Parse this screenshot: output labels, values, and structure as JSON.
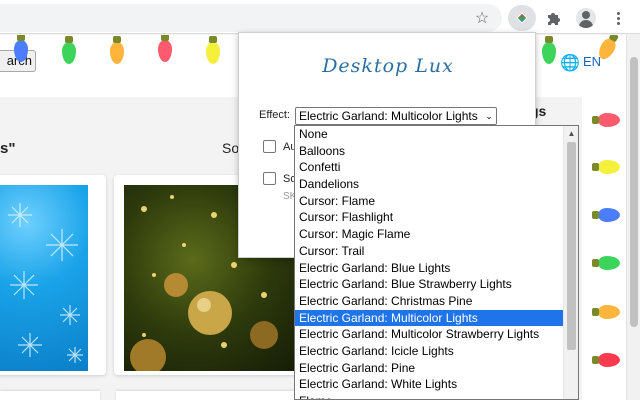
{
  "page": {
    "search_button": "arch",
    "language": "EN",
    "left_heading": "s\"",
    "center_heading": "So",
    "right_heading": "gs"
  },
  "popup": {
    "title": "Desktop Lux",
    "effect_label": "Effect:",
    "selected_effect": "Electric Garland: Multicolor Lights",
    "checkbox1_label": "Au",
    "checkbox2_label": "So",
    "checkbox2_sub": "SK"
  },
  "dropdown": {
    "options": [
      "None",
      "Balloons",
      "Confetti",
      "Dandelions",
      "Cursor: Flame",
      "Cursor: Flashlight",
      "Cursor: Magic Flame",
      "Cursor: Trail",
      "Electric Garland: Blue Lights",
      "Electric Garland: Blue Strawberry Lights",
      "Electric Garland: Christmas Pine",
      "Electric Garland: Multicolor Lights",
      "Electric Garland: Multicolor Strawberry Lights",
      "Electric Garland: Icicle Lights",
      "Electric Garland: Pine",
      "Electric Garland: White Lights",
      "Flame"
    ],
    "selected_index": 11
  },
  "icons": {
    "bookmark": "star-icon",
    "extension": "desktop-lux-extension-icon",
    "extensions_menu": "puzzle-icon",
    "profile": "avatar-icon",
    "menu": "kebab-menu-icon",
    "globe": "globe-icon"
  },
  "colors": {
    "accent_title": "#2c6ea3",
    "selection": "#1e74e8",
    "link": "#1565c0"
  }
}
